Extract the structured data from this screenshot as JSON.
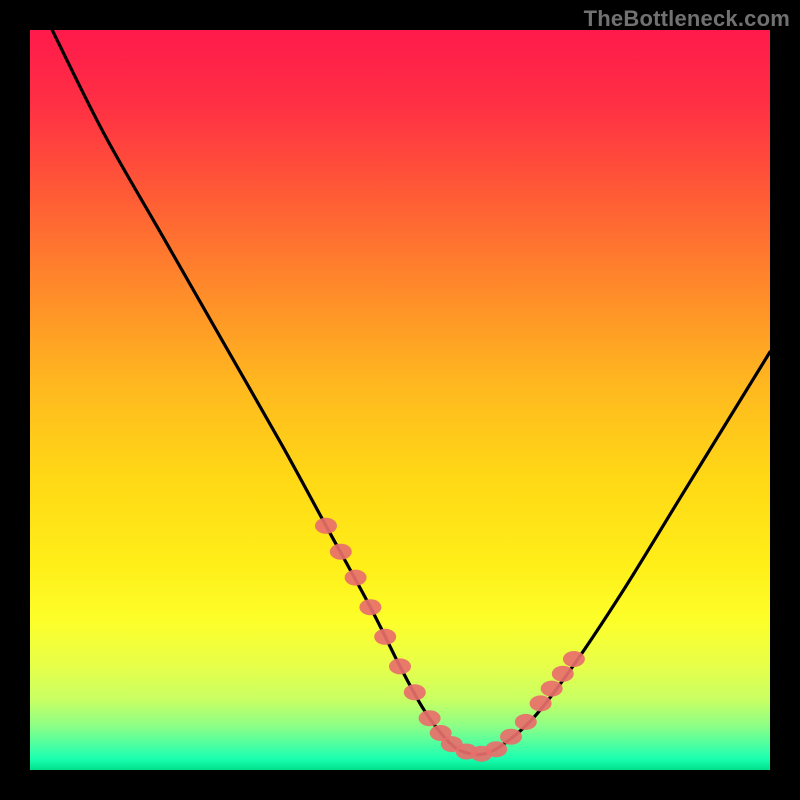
{
  "watermark": {
    "text": "TheBottleneck.com"
  },
  "gradient_stops": [
    {
      "offset": 0.0,
      "color": "#ff1a4b"
    },
    {
      "offset": 0.1,
      "color": "#ff2f44"
    },
    {
      "offset": 0.22,
      "color": "#ff5a36"
    },
    {
      "offset": 0.35,
      "color": "#ff8a2a"
    },
    {
      "offset": 0.48,
      "color": "#ffb81f"
    },
    {
      "offset": 0.6,
      "color": "#ffd716"
    },
    {
      "offset": 0.72,
      "color": "#ffee18"
    },
    {
      "offset": 0.8,
      "color": "#fdff2a"
    },
    {
      "offset": 0.86,
      "color": "#e6ff4a"
    },
    {
      "offset": 0.905,
      "color": "#c8ff63"
    },
    {
      "offset": 0.94,
      "color": "#8dff86"
    },
    {
      "offset": 0.965,
      "color": "#4fffa0"
    },
    {
      "offset": 0.985,
      "color": "#1affb0"
    },
    {
      "offset": 1.0,
      "color": "#00e08a"
    }
  ],
  "marker_color": "#e86f6b",
  "chart_data": {
    "type": "line",
    "title": "",
    "xlabel": "",
    "ylabel": "",
    "xlim": [
      0,
      100
    ],
    "ylim": [
      0,
      100
    ],
    "series": [
      {
        "name": "bottleneck-curve",
        "x": [
          3,
          10,
          18,
          26,
          34,
          40,
          46,
          50,
          53,
          55.5,
          57.5,
          59.5,
          61.5,
          64,
          68,
          73,
          80,
          88,
          96,
          100
        ],
        "y": [
          100,
          86,
          72,
          58,
          44,
          33,
          22,
          14,
          8.5,
          5,
          3,
          2.2,
          2.2,
          3.5,
          7,
          13.5,
          24,
          37,
          50,
          56.5
        ]
      }
    ],
    "markers": {
      "name": "highlighted-points",
      "x": [
        40,
        42,
        44,
        46,
        48,
        50,
        52,
        54,
        55.5,
        57,
        59,
        61,
        63,
        65,
        67,
        69,
        70.5,
        72,
        73.5
      ],
      "y": [
        33,
        29.5,
        26,
        22,
        18,
        14,
        10.5,
        7,
        5,
        3.5,
        2.5,
        2.2,
        2.8,
        4.5,
        6.5,
        9,
        11,
        13,
        15
      ]
    }
  }
}
